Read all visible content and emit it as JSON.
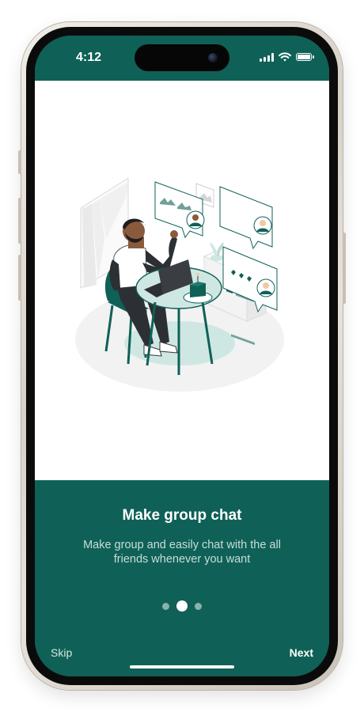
{
  "status_bar": {
    "time": "4:12",
    "icons": [
      "signal-icon",
      "wifi-icon",
      "battery-icon"
    ]
  },
  "onboarding": {
    "title": "Make group chat",
    "subtitle": "Make group and easily chat with the all friends whenever you want",
    "illustration": "man-at-table-with-laptop-and-chat-bubbles",
    "pagination": {
      "total": 3,
      "current": 2
    }
  },
  "navigation": {
    "skip_label": "Skip",
    "next_label": "Next"
  },
  "colors": {
    "primary": "#0f6157",
    "accent_light": "#cfe7e2",
    "background": "#ffffff"
  }
}
